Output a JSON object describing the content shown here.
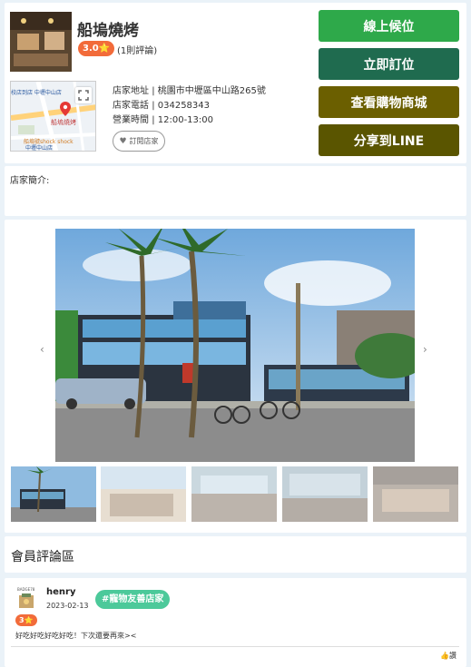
{
  "store": {
    "name": "船塢燒烤",
    "rating": "3.0⭐",
    "review_count": "(1則評論)",
    "address_label": "店家地址",
    "address": "桃園市中壢區中山路265號",
    "phone_label": "店家電話",
    "phone": "034258343",
    "hours_label": "營業時間",
    "hours": "12:00-13:00",
    "follow_label": "訂閱店家",
    "intro_label": "店家簡介:"
  },
  "map": {
    "store_marker_label": "船塢燒烤",
    "nearby_top": "校店到店 中壢中山店",
    "nearby_bottom": "船塢號shock shock",
    "nearby_bottom2": "中壢中山店"
  },
  "actions": [
    {
      "label": "線上候位",
      "color": "#2ea94a"
    },
    {
      "label": "立即訂位",
      "color": "#1f6b4f"
    },
    {
      "label": "查看購物商城",
      "color": "#6b5f00"
    },
    {
      "label": "分享到LINE",
      "color": "#5a5500"
    }
  ],
  "gallery": {
    "prev_icon": "‹",
    "next_icon": "›",
    "thumb_count": 5
  },
  "reviews": {
    "section_title": "會員評論區",
    "items": [
      {
        "avatar_caption": "BADGE78",
        "name": "henry",
        "date": "2023-02-13",
        "tag": "#寵物友善店家",
        "rating": "3⭐",
        "text": "好吃好吃好吃好吃！下次還要再來><",
        "like_label": "讚"
      }
    ]
  }
}
